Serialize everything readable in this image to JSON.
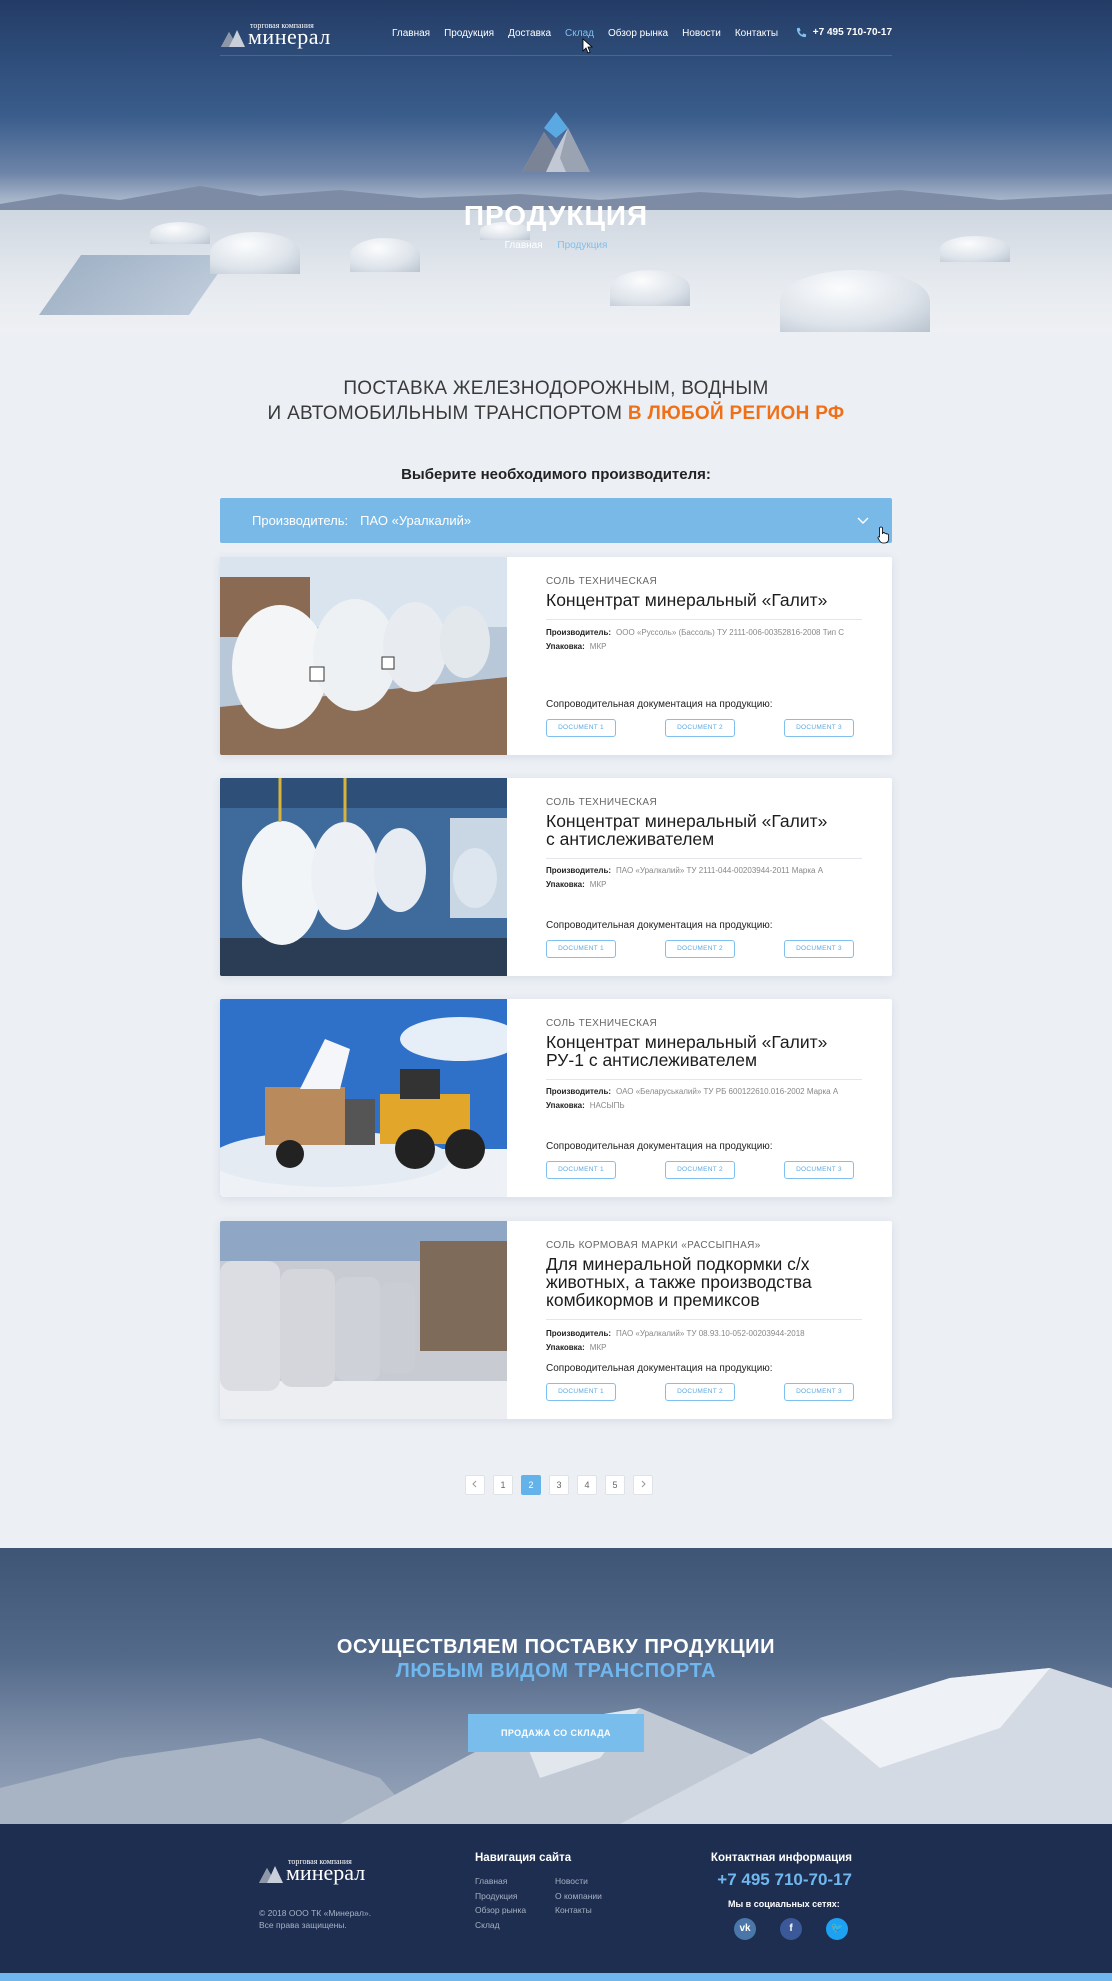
{
  "header": {
    "logo_small": "торговая компания",
    "logo_big": "минерал",
    "nav": [
      "Главная",
      "Продукция",
      "Доставка",
      "Склад",
      "Обзор рынка",
      "Новости",
      "Контакты"
    ],
    "active_nav": "Склад",
    "phone": "+7 495 710-70-17",
    "page_title": "ПРОДУКЦИЯ",
    "breadcrumb_home": "Главная",
    "breadcrumb_current": "Продукция"
  },
  "intro": {
    "line1": "ПОСТАВКА ЖЕЛЕЗНОДОРОЖНЫМ, ВОДНЫМ",
    "line2": "И АВТОМОБИЛЬНЫМ ТРАНСПОРТОМ",
    "highlight": "В ЛЮБОЙ РЕГИОН РФ",
    "pick": "Выберите необходимого производителя:"
  },
  "manufacturer_select": {
    "label": "Производитель:",
    "value": "ПАО «Уралкалий»"
  },
  "labels": {
    "producer": "Производитель:",
    "packing": "Упаковка:",
    "docs": "Сопроводительная документация на продукцию:"
  },
  "products": [
    {
      "category": "СОЛЬ ТЕХНИЧЕСКАЯ",
      "name": [
        "Концентрат минеральный «Галит»"
      ],
      "producer": "ООО «Руссоль» (Бассоль) ТУ 2111-006-00352816-2008 Тип С",
      "packing": "МКР",
      "docs": [
        "DOCUMENT 1",
        "DOCUMENT 2",
        "DOCUMENT 3"
      ]
    },
    {
      "category": "СОЛЬ ТЕХНИЧЕСКАЯ",
      "name": [
        "Концентрат минеральный «Галит»",
        "с антислеживателем"
      ],
      "producer": "ПАО «Уралкалий» ТУ 2111-044-00203944-2011 Марка А",
      "packing": "МКР",
      "docs": [
        "DOCUMENT 1",
        "DOCUMENT 2",
        "DOCUMENT 3"
      ]
    },
    {
      "category": "СОЛЬ ТЕХНИЧЕСКАЯ",
      "name": [
        "Концентрат минеральный «Галит»",
        "РУ-1 с антислеживателем"
      ],
      "producer": "ОАО «Беларуськалий» ТУ РБ 600122610.016-2002 Марка А",
      "packing": "НАСЫПЬ",
      "docs": [
        "DOCUMENT 1",
        "DOCUMENT 2",
        "DOCUMENT 3"
      ]
    },
    {
      "category": "СОЛЬ КОРМОВАЯ МАРКИ «РАССЫПНАЯ»",
      "name": [
        "Для минеральной подкормки с/х",
        "животных, а также производства",
        "комбикормов и премиксов"
      ],
      "producer": "ПАО «Уралкалий» ТУ 08.93.10-052-00203944-2018",
      "packing": "МКР",
      "docs": [
        "DOCUMENT 1",
        "DOCUMENT 2",
        "DOCUMENT 3"
      ]
    }
  ],
  "pagination": {
    "pages": [
      "1",
      "2",
      "3",
      "4",
      "5"
    ],
    "current": "2"
  },
  "banner": {
    "line1": "ОСУЩЕСТВЛЯЕМ ПОСТАВКУ ПРОДУКЦИИ",
    "line2": "ЛЮБЫМ ВИДОМ ТРАНСПОРТА",
    "cta": "ПРОДАЖА СО СКЛАДА"
  },
  "footer": {
    "copyright_line1": "© 2018 ООО ТК «Минерал».",
    "copyright_line2": "Все права защищены.",
    "nav_title": "Навигация сайта",
    "nav_col1": [
      "Главная",
      "Продукция",
      "Обзор рынка",
      "Склад"
    ],
    "nav_col2": [
      "Новости",
      "О компании",
      "Контакты"
    ],
    "contact_title": "Контактная информация",
    "phone": "+7 495 710-70-17",
    "social_title": "Мы в социальных сетях:",
    "social": [
      {
        "name": "vk-icon",
        "glyph": "vk",
        "color": "#4a76a8"
      },
      {
        "name": "facebook-icon",
        "glyph": "f",
        "color": "#3b5998"
      },
      {
        "name": "twitter-icon",
        "glyph": "🐦",
        "color": "#1da1f2"
      }
    ]
  },
  "colors": {
    "accent": "#79b9e8",
    "highlight": "#f07018",
    "footer": "#1e2e50"
  }
}
